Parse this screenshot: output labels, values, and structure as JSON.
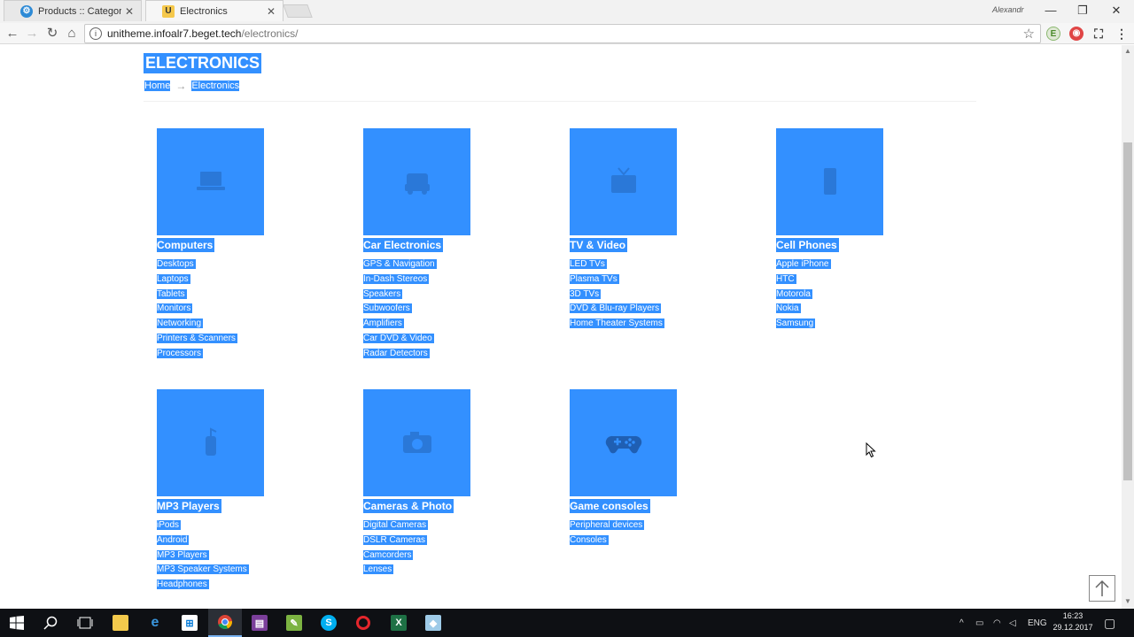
{
  "browser": {
    "tabs": [
      {
        "title": "Products :: Categories - /",
        "favicon": "gear-icon"
      },
      {
        "title": "Electronics",
        "favicon": "U"
      }
    ],
    "user": "Alexandr",
    "url_host": "unitheme.infoalr7.beget.tech",
    "url_path": "/electronics/"
  },
  "page": {
    "title": "ELECTRONICS",
    "breadcrumb": {
      "home": "Home",
      "separator": "→",
      "current": "Electronics"
    },
    "accent_color": "#3390ff",
    "categories": [
      {
        "title": "Computers",
        "icon": "laptop-icon",
        "items": [
          "Desktops",
          "Laptops",
          "Tablets",
          "Monitors",
          "Networking",
          "Printers & Scanners",
          "Processors"
        ]
      },
      {
        "title": "Car Electronics",
        "icon": "car-icon",
        "items": [
          "GPS & Navigation",
          "In-Dash Stereos",
          "Speakers",
          "Subwoofers",
          "Amplifiers",
          "Car DVD & Video",
          "Radar Detectors"
        ]
      },
      {
        "title": "TV & Video",
        "icon": "tv-icon",
        "items": [
          "LED TVs",
          "Plasma TVs",
          "3D TVs",
          "DVD & Blu-ray Players",
          "Home Theater Systems"
        ]
      },
      {
        "title": "Cell Phones",
        "icon": "phone-icon",
        "items": [
          "Apple iPhone",
          "HTC",
          "Motorola",
          "Nokia",
          "Samsung"
        ]
      },
      {
        "title": "MP3 Players",
        "icon": "mp3-player-icon",
        "items": [
          "iPods",
          "Android",
          "MP3 Players",
          "MP3 Speaker Systems",
          "Headphones"
        ]
      },
      {
        "title": "Cameras & Photo",
        "icon": "camera-icon",
        "items": [
          "Digital Cameras",
          "DSLR Cameras",
          "Camcorders",
          "Lenses"
        ]
      },
      {
        "title": "Game consoles",
        "icon": "gamepad-icon",
        "items": [
          "Peripheral devices",
          "Consoles"
        ]
      }
    ]
  },
  "taskbar": {
    "language": "ENG",
    "time": "16:23",
    "date": "29.12.2017"
  }
}
